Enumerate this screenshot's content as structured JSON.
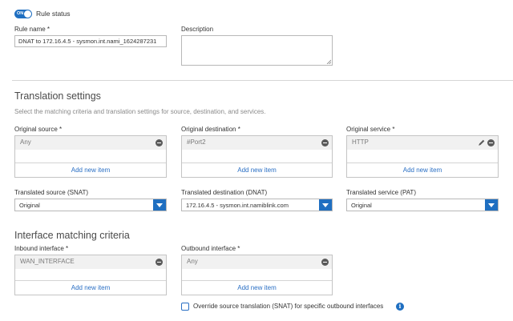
{
  "rule_status": {
    "toggle_text": "ON",
    "label": "Rule status"
  },
  "rule_name": {
    "label": "Rule name *",
    "value": "DNAT to 172.16.4.5 - sysmon.int.nami_1624287231"
  },
  "description": {
    "label": "Description",
    "value": ""
  },
  "translation": {
    "title": "Translation settings",
    "description": "Select the matching criteria and translation settings for source, destination, and services.",
    "original_source": {
      "label": "Original source *",
      "item": "Any",
      "add": "Add new item"
    },
    "original_destination": {
      "label": "Original destination *",
      "item": "#Port2",
      "add": "Add new item"
    },
    "original_service": {
      "label": "Original service *",
      "item": "HTTP",
      "add": "Add new item"
    },
    "translated_source": {
      "label": "Translated source (SNAT)",
      "value": "Original"
    },
    "translated_destination": {
      "label": "Translated destination (DNAT)",
      "value": "172.16.4.5 - sysmon.int.namiblink.com"
    },
    "translated_service": {
      "label": "Translated service (PAT)",
      "value": "Original"
    }
  },
  "interface": {
    "title": "Interface matching criteria",
    "inbound": {
      "label": "Inbound interface *",
      "item": "WAN_INTERFACE",
      "add": "Add new item"
    },
    "outbound": {
      "label": "Outbound interface *",
      "item": "Any",
      "add": "Add new item"
    },
    "override_label": "Override source translation (SNAT) for specific outbound interfaces"
  },
  "colors": {
    "accent": "#1f6fc1",
    "link": "#2a6fc4"
  },
  "icons": {
    "remove": "minus-circle-icon",
    "edit": "pencil-icon",
    "info": "info-icon",
    "dropdown": "chevron-down-icon"
  }
}
